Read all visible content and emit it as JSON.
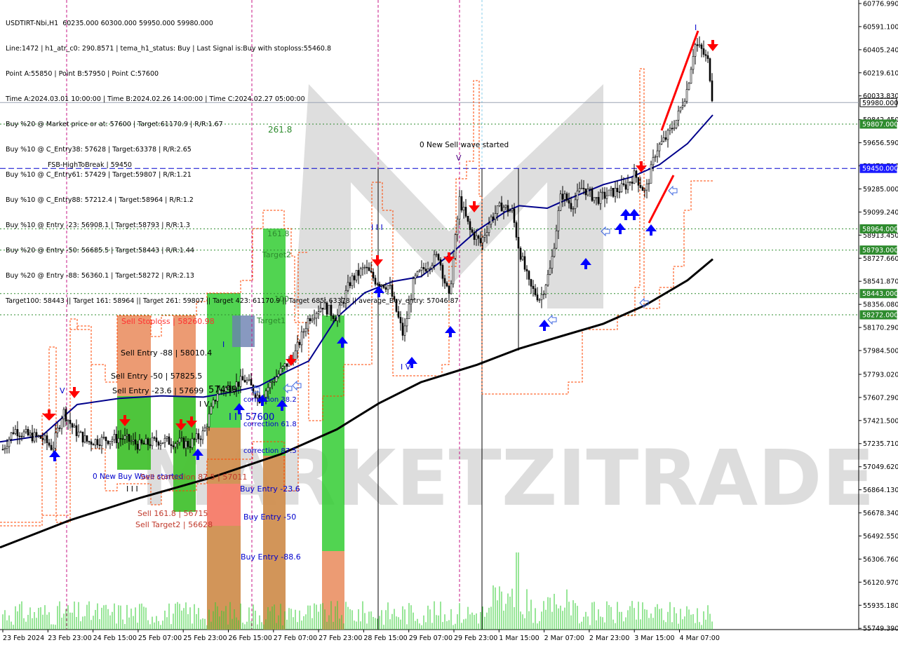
{
  "info_lines": [
    "USDTIRT-Nbi,H1  60235.000 60300.000 59950.000 59980.000",
    "Line:1472 | h1_atr_c0: 290.8571 | tema_h1_status: Buy | Last Signal is:Buy with stoploss:55460.8",
    "Point A:55850 | Point B:57950 | Point C:57600",
    "Time A:2024.03.01 10:00:00 | Time B:2024.02.26 14:00:00 | Time C:2024.02.27 05:00:00",
    "Buy %20 @ Market price or at: 57600 | Target:61170.9 | R/R:1.67",
    "Buy %10 @ C_Entry38: 57628 | Target:63378 | R/R:2.65",
    "Buy %10 @ C_Entry61: 57429 | Target:59807 | R/R:1.21",
    "Buy %10 @ C_Entry88: 57212.4 | Target:58964 | R/R:1.2",
    "Buy %10 @ Entry -23: 56908.1 | Target:58793 | R/R:1.3",
    "Buy %20 @ Entry -50: 56685.5 | Target:58443 | R/R:1.44",
    "Buy %20 @ Entry -88: 56360.1 | Target:58272 | R/R:2.13",
    "Target100: 58443 || Target 161: 58964 || Target 261: 59807 || Target 423: 61170.9 || Target 685: 63378 || average_Buy_entry: 57046.87"
  ],
  "watermark": "MARKETZITRADE",
  "price_axis": {
    "ticks": [
      "60776.990",
      "60591.100",
      "60405.240",
      "60219.610",
      "60033.830",
      "59842.450",
      "59656.590",
      "59470.710",
      "59285.000",
      "59099.240",
      "58913.450",
      "58727.660",
      "58541.870",
      "58356.080",
      "58170.290",
      "57984.500",
      "57793.020",
      "57607.290",
      "57421.500",
      "57235.710",
      "57049.620",
      "56864.130",
      "56678.340",
      "56492.550",
      "56306.760",
      "56120.970",
      "55935.180",
      "55749.390"
    ],
    "price_labels": [
      {
        "text": "59980.000",
        "bg": "#ffffff",
        "fg": "#000000",
        "price": 59980
      },
      {
        "text": "59807.000",
        "bg": "#2e8b2e",
        "fg": "#ffffff",
        "price": 59807
      },
      {
        "text": "59450.000",
        "bg": "#1a1aff",
        "fg": "#ffffff",
        "price": 59450
      },
      {
        "text": "58964.000",
        "bg": "#2e8b2e",
        "fg": "#ffffff",
        "price": 58964
      },
      {
        "text": "58793.000",
        "bg": "#2e8b2e",
        "fg": "#ffffff",
        "price": 58793
      },
      {
        "text": "58443.000",
        "bg": "#2e8b2e",
        "fg": "#ffffff",
        "price": 58443
      },
      {
        "text": "58272.000",
        "bg": "#2e8b2e",
        "fg": "#ffffff",
        "price": 58272
      }
    ]
  },
  "time_axis": [
    "23 Feb 2024",
    "23 Feb 23:00",
    "24 Feb 15:00",
    "25 Feb 07:00",
    "25 Feb 23:00",
    "26 Feb 15:00",
    "27 Feb 07:00",
    "27 Feb 23:00",
    "28 Feb 15:00",
    "29 Feb 07:00",
    "29 Feb 23:00",
    "1 Mar 15:00",
    "2 Mar 07:00",
    "2 Mar 23:00",
    "3 Mar 15:00",
    "4 Mar 07:00"
  ],
  "annotations": {
    "fsb": "FSB-HighToBreak | 59450",
    "fib2618": "261.8",
    "new_sell_wave": "0 New Sell wave started",
    "fib1618": "161.8",
    "target2": "Target2",
    "fib100": "100",
    "target1": "Target1",
    "sell_stoploss": "Sell Stoploss | 58260.98",
    "sell_entry_88": "Sell Entry -88 | 58010.4",
    "sell_entry_50": "Sell Entry -50 | 57825.5",
    "sell_entry_23": "Sell Entry -23.6 | 57699",
    "mid_price": "57499",
    "correction_38": "correction 38.2",
    "c_point": "I I I 57600",
    "correction_61": "correction 61.8",
    "correction_87": "correction 87.5",
    "new_buy_wave": "0 New Buy Wave started",
    "sell_correction": "Sell correction 87.5 | 57011",
    "buy_entry_23": "Buy Entry -23.6",
    "sell_161": "Sell 161.8 | 56715",
    "sell_target2": "Sell Target2 | 56628",
    "buy_entry_50": "Buy Entry -50",
    "buy_entry_88": "Buy Entry -88.6",
    "wave_iii": "I I I",
    "wave_iii_b": "I I I",
    "wave_iv": "I V",
    "wave_iv_b": "I V",
    "wave_v": "V",
    "wave_v_b": "V",
    "wave_i": "I",
    "wave_i_top": "I"
  },
  "colors": {
    "bull": "#000000",
    "ma_blue": "#00008b",
    "ma_black": "#000000",
    "green_box": "#32cd32",
    "orange_box": "#e9895a",
    "red_signal": "#ff0000",
    "blue_signal": "#0000ff",
    "dotted_green": "#2e8b2e",
    "dashed_blue": "#0000cd",
    "stop_orange": "#ff4500",
    "volume": "#32cd32"
  },
  "chart_data": {
    "type": "candlestick",
    "symbol": "USDTIRT-Nbi",
    "timeframe": "H1",
    "ylim": [
      55700,
      60790
    ],
    "ohlc_last": {
      "open": 60235.0,
      "high": 60300.0,
      "low": 59950.0,
      "close": 59980.0
    },
    "close_path": [
      [
        0,
        57150
      ],
      [
        20,
        57350
      ],
      [
        40,
        57300
      ],
      [
        60,
        57280
      ],
      [
        75,
        57200
      ],
      [
        90,
        57500
      ],
      [
        105,
        57350
      ],
      [
        125,
        57250
      ],
      [
        150,
        57270
      ],
      [
        175,
        57280
      ],
      [
        200,
        57220
      ],
      [
        225,
        57260
      ],
      [
        250,
        57250
      ],
      [
        270,
        57230
      ],
      [
        290,
        57320
      ],
      [
        310,
        57650
      ],
      [
        330,
        57700
      ],
      [
        350,
        57750
      ],
      [
        370,
        57600
      ],
      [
        390,
        57750
      ],
      [
        405,
        57850
      ],
      [
        420,
        57950
      ],
      [
        440,
        58250
      ],
      [
        460,
        58350
      ],
      [
        480,
        58250
      ],
      [
        500,
        58550
      ],
      [
        520,
        58650
      ],
      [
        535,
        58550
      ],
      [
        555,
        58500
      ],
      [
        575,
        58100
      ],
      [
        590,
        58550
      ],
      [
        605,
        58650
      ],
      [
        625,
        58750
      ],
      [
        640,
        58400
      ],
      [
        655,
        59200
      ],
      [
        670,
        58950
      ],
      [
        685,
        58850
      ],
      [
        700,
        59050
      ],
      [
        715,
        59150
      ],
      [
        730,
        59100
      ],
      [
        740,
        58800
      ],
      [
        755,
        58500
      ],
      [
        770,
        58400
      ],
      [
        785,
        58650
      ],
      [
        800,
        59250
      ],
      [
        815,
        59150
      ],
      [
        830,
        59300
      ],
      [
        850,
        59200
      ],
      [
        870,
        59250
      ],
      [
        890,
        59300
      ],
      [
        905,
        59400
      ],
      [
        920,
        59250
      ],
      [
        935,
        59600
      ],
      [
        950,
        59700
      ],
      [
        965,
        59850
      ],
      [
        980,
        60100
      ],
      [
        990,
        60450
      ],
      [
        1000,
        60400
      ],
      [
        1010,
        60300
      ],
      [
        1016,
        59980
      ]
    ],
    "series": [
      {
        "name": "tema_h1",
        "points": [
          [
            0,
            57250
          ],
          [
            60,
            57300
          ],
          [
            110,
            57550
          ],
          [
            170,
            57600
          ],
          [
            230,
            57620
          ],
          [
            290,
            57610
          ],
          [
            330,
            57650
          ],
          [
            370,
            57700
          ],
          [
            410,
            57820
          ],
          [
            440,
            57900
          ],
          [
            480,
            58250
          ],
          [
            520,
            58450
          ],
          [
            560,
            58540
          ],
          [
            600,
            58580
          ],
          [
            640,
            58750
          ],
          [
            680,
            58950
          ],
          [
            720,
            59100
          ],
          [
            740,
            59150
          ],
          [
            780,
            59130
          ],
          [
            800,
            59180
          ],
          [
            830,
            59250
          ],
          [
            860,
            59320
          ],
          [
            900,
            59380
          ],
          [
            940,
            59480
          ],
          [
            980,
            59650
          ],
          [
            1016,
            59880
          ]
        ]
      },
      {
        "name": "ma_long",
        "points": [
          [
            0,
            56400
          ],
          [
            100,
            56620
          ],
          [
            200,
            56800
          ],
          [
            300,
            56960
          ],
          [
            400,
            57150
          ],
          [
            480,
            57350
          ],
          [
            540,
            57560
          ],
          [
            600,
            57730
          ],
          [
            680,
            57870
          ],
          [
            740,
            58000
          ],
          [
            800,
            58100
          ],
          [
            860,
            58200
          ],
          [
            920,
            58350
          ],
          [
            980,
            58550
          ],
          [
            1016,
            58720
          ]
        ]
      }
    ],
    "levels": [
      {
        "name": "Target 261",
        "price": 59807,
        "style": "dotted",
        "color": "#2e8b2e"
      },
      {
        "name": "FSB-HighToBreak",
        "price": 59450,
        "style": "dashed",
        "color": "#0000cd"
      },
      {
        "name": "Target 161",
        "price": 58964,
        "style": "dotted",
        "color": "#2e8b2e"
      },
      {
        "name": "Target2",
        "price": 58793,
        "style": "dotted",
        "color": "#2e8b2e"
      },
      {
        "name": "Target100",
        "price": 58443,
        "style": "dotted",
        "color": "#2e8b2e"
      },
      {
        "name": "Target1",
        "price": 58272,
        "style": "dotted",
        "color": "#2e8b2e"
      }
    ]
  }
}
